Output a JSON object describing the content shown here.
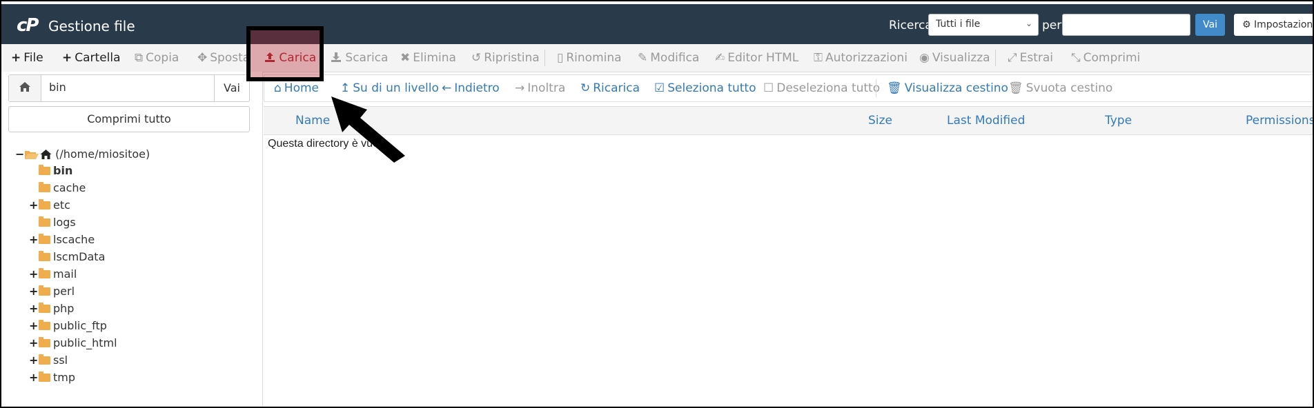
{
  "header": {
    "title": "Gestione file",
    "search_label": "Ricerca",
    "search_scope": "Tutti i file",
    "per_label": "per",
    "search_value": "",
    "go_label": "Vai",
    "settings_label": "Impostazioni"
  },
  "toolbar": {
    "file": "File",
    "cartella": "Cartella",
    "copia": "Copia",
    "sposta": "Sposta",
    "carica": "Carica",
    "scarica": "Scarica",
    "elimina": "Elimina",
    "ripristina": "Ripristina",
    "rinomina": "Rinomina",
    "modifica": "Modifica",
    "editor_html": "Editor HTML",
    "autorizzazioni": "Autorizzazioni",
    "visualizza": "Visualizza",
    "estrai": "Estrai",
    "comprimi": "Comprimi"
  },
  "left_panel": {
    "path_value": "bin",
    "go_label": "Vai",
    "collapse_label": "Comprimi tutto",
    "root_label": "(/home/miositoe)",
    "tree": [
      {
        "label": "bin",
        "expandable": false,
        "selected": true
      },
      {
        "label": "cache",
        "expandable": false,
        "selected": false
      },
      {
        "label": "etc",
        "expandable": true,
        "selected": false
      },
      {
        "label": "logs",
        "expandable": false,
        "selected": false
      },
      {
        "label": "lscache",
        "expandable": true,
        "selected": false
      },
      {
        "label": "lscmData",
        "expandable": false,
        "selected": false
      },
      {
        "label": "mail",
        "expandable": true,
        "selected": false
      },
      {
        "label": "perl",
        "expandable": true,
        "selected": false
      },
      {
        "label": "php",
        "expandable": true,
        "selected": false
      },
      {
        "label": "public_ftp",
        "expandable": true,
        "selected": false
      },
      {
        "label": "public_html",
        "expandable": true,
        "selected": false
      },
      {
        "label": "ssl",
        "expandable": true,
        "selected": false
      },
      {
        "label": "tmp",
        "expandable": true,
        "selected": false
      }
    ]
  },
  "nav": {
    "home": "Home",
    "up": "Su di un livello",
    "back": "Indietro",
    "forward": "Inoltra",
    "reload": "Ricarica",
    "select_all": "Seleziona tutto",
    "deselect_all": "Deseleziona tutto",
    "view_trash": "Visualizza cestino",
    "empty_trash": "Svuota cestino"
  },
  "table": {
    "columns": [
      "Name",
      "Size",
      "Last Modified",
      "Type",
      "Permissions"
    ],
    "empty_message": "Questa directory è vuota."
  },
  "colors": {
    "header_bg": "#293a4a",
    "link_blue": "#337ab7",
    "button_blue": "#428bca",
    "folder": "#f0ad4e",
    "highlight": "#b41e28"
  }
}
